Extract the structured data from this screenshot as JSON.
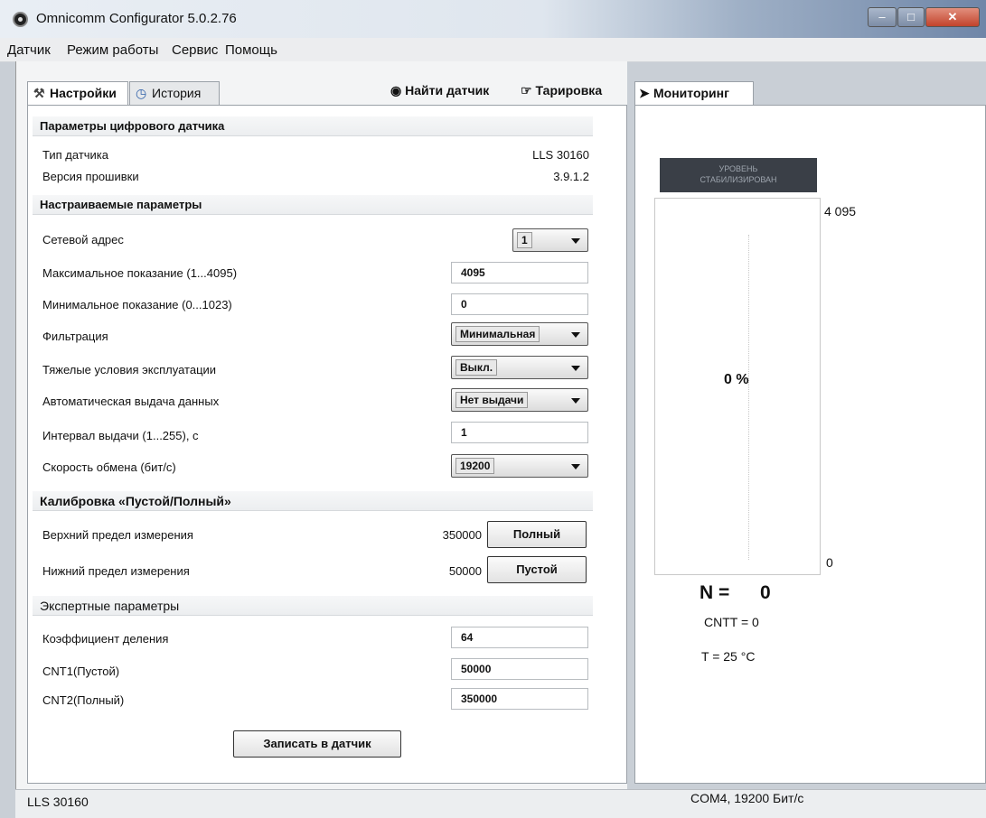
{
  "window": {
    "title": "Omnicomm Configurator 5.0.2.76"
  },
  "menu": [
    "Датчик",
    "Режим работы",
    "Сервис",
    "Помощь"
  ],
  "tabs": {
    "settings": "Настройки",
    "history": "История",
    "monitoring": "Мониторинг"
  },
  "toolbar": {
    "find_sensor": "Найти датчик",
    "calibration": "Тарировка"
  },
  "digital_params": {
    "title": "Параметры цифрового датчика",
    "sensor_type_label": "Тип датчика",
    "sensor_type_value": "LLS 30160",
    "firmware_label": "Версия прошивки",
    "firmware_value": "3.9.1.2"
  },
  "configurable": {
    "title": "Настраиваемые параметры",
    "network_address_label": "Сетевой адрес",
    "network_address_value": "1",
    "max_reading_label": "Максимальное показание  (1...4095)",
    "max_reading_value": "4095",
    "min_reading_label": "Минимальное показание (0...1023)",
    "min_reading_value": "0",
    "filter_label": "Фильтрация",
    "filter_value": "Минимальная",
    "heavy_conditions_label": "Тяжелые условия эксплуатации",
    "heavy_conditions_value": "Выкл.",
    "auto_output_label": "Автоматическая выдача данных",
    "auto_output_value": "Нет выдачи",
    "interval_label": "Интервал выдачи (1...255), с",
    "interval_value": "1",
    "baud_label": "Скорость обмена (бит/с)",
    "baud_value": "19200"
  },
  "calibration": {
    "title": "Калибровка «Пустой/Полный»",
    "upper_label": "Верхний предел измерения",
    "upper_value": "350000",
    "full_button": "Полный",
    "lower_label": "Нижний предел измерения",
    "lower_value": "50000",
    "empty_button": "Пустой"
  },
  "expert": {
    "title": "Экспертные параметры",
    "divider_label": "Коэффициент деления",
    "divider_value": "64",
    "cnt1_label": "CNT1(Пустой)",
    "cnt1_value": "50000",
    "cnt2_label": "CNT2(Полный)",
    "cnt2_value": "350000"
  },
  "write_button": "Записать в датчик",
  "monitoring": {
    "level_badge_line1": "УРОВЕНЬ",
    "level_badge_line2": "СТАБИЛИЗИРОВАН",
    "scale_max": "4 095",
    "scale_min": "0",
    "fill_percent": 0,
    "percent_text": "0 %",
    "n_label": "N =",
    "n_value": "0",
    "cntt": "CNTT = 0",
    "temperature": "T =  25 °C"
  },
  "status": {
    "left": "LLS 30160",
    "right": "COM4, 19200 Бит/с"
  },
  "colors": {
    "gauge_fill": "#3a78c2",
    "badge_bg": "#3a3f47"
  }
}
